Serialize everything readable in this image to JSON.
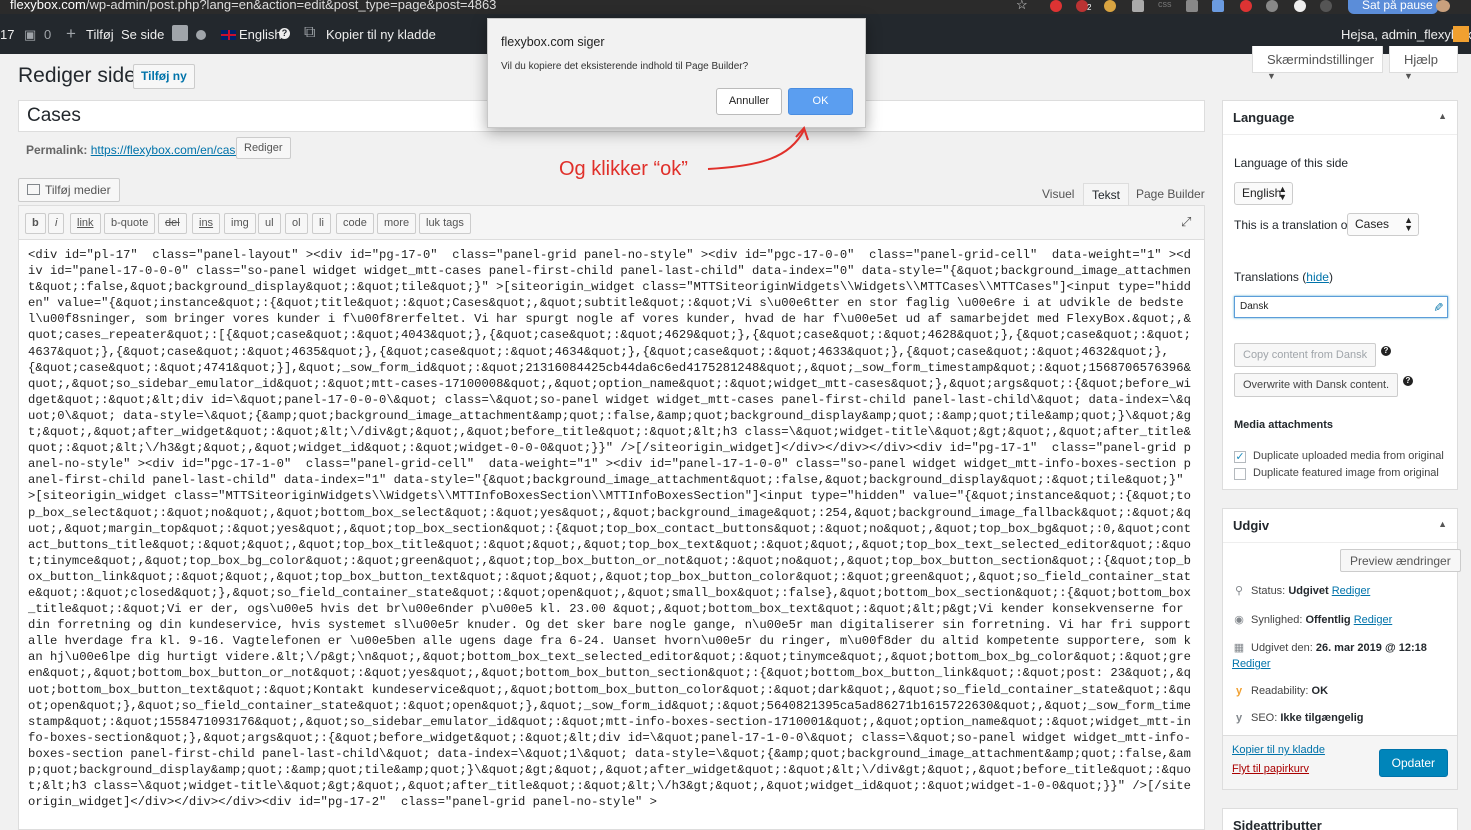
{
  "browser": {
    "url_host": "flexybox.com",
    "url_path": "/wp-admin/post.php?lang=en&action=edit&post_type=page&post=4863",
    "star_label": "☆",
    "badge_count": "2",
    "css_label": "css",
    "pause_label": "Sat på pause"
  },
  "admin_bar": {
    "counter": "17",
    "comments": "0",
    "add_new": "Tilføj",
    "view_page": "Se side",
    "language": "English",
    "help_mark": "?",
    "copy_draft": "Kopier til ny kladde",
    "greeting": "Hejsa, admin_flexybox"
  },
  "header": {
    "screen_options": "Skærmindstillinger",
    "help": "Hjælp",
    "title": "Rediger side",
    "add_new": "Tilføj ny"
  },
  "post": {
    "title": "Cases",
    "permalink_label": "Permalink:",
    "permalink_url": "https://flexybox.com/en/cases/",
    "permalink_edit": "Rediger",
    "add_media": "Tilføj medier"
  },
  "editor": {
    "tabs": [
      "Visuel",
      "Tekst",
      "Page Builder"
    ],
    "quicktags": [
      "b",
      "i",
      "link",
      "b-quote",
      "del",
      "ins",
      "img",
      "ul",
      "ol",
      "li",
      "code",
      "more",
      "luk tags"
    ],
    "content": "<div id=\"pl-17\"  class=\"panel-layout\" ><div id=\"pg-17-0\"  class=\"panel-grid panel-no-style\" ><div id=\"pgc-17-0-0\"  class=\"panel-grid-cell\"  data-weight=\"1\" ><div id=\"panel-17-0-0-0\" class=\"so-panel widget widget_mtt-cases panel-first-child panel-last-child\" data-index=\"0\" data-style=\"{&quot;background_image_attachment&quot;:false,&quot;background_display&quot;:&quot;tile&quot;}\" >[siteorigin_widget class=\"MTTSiteoriginWidgets\\\\Widgets\\\\MTTCases\\\\MTTCases\"]<input type=\"hidden\" value=\"{&quot;instance&quot;:{&quot;title&quot;:&quot;Cases&quot;,&quot;subtitle&quot;:&quot;Vi s\\u00e6tter en stor faglig \\u00e6re i at udvikle de bedste l\\u00f8sninger, som bringer vores kunder i f\\u00f8rerfeltet. Vi har spurgt nogle af vores kunder, hvad de har f\\u00e5et ud af samarbejdet med FlexyBox.&quot;,&quot;cases_repeater&quot;:[{&quot;case&quot;:&quot;4043&quot;},{&quot;case&quot;:&quot;4629&quot;},{&quot;case&quot;:&quot;4628&quot;},{&quot;case&quot;:&quot;4637&quot;},{&quot;case&quot;:&quot;4635&quot;},{&quot;case&quot;:&quot;4634&quot;},{&quot;case&quot;:&quot;4633&quot;},{&quot;case&quot;:&quot;4632&quot;},\n{&quot;case&quot;:&quot;4741&quot;}],&quot;_sow_form_id&quot;:&quot;21316084425cb44da6c6ed4175281248&quot;,&quot;_sow_form_timestamp&quot;:&quot;1568706576396&quot;,&quot;so_sidebar_emulator_id&quot;:&quot;mtt-cases-17100008&quot;,&quot;option_name&quot;:&quot;widget_mtt-cases&quot;},&quot;args&quot;:{&quot;before_widget&quot;:&quot;&lt;div id=\\&quot;panel-17-0-0-0\\&quot; class=\\&quot;so-panel widget widget_mtt-cases panel-first-child panel-last-child\\&quot; data-index=\\&quot;0\\&quot; data-style=\\&quot;{&amp;quot;background_image_attachment&amp;quot;:false,&amp;quot;background_display&amp;quot;:&amp;quot;tile&amp;quot;}\\&quot;&gt;&quot;,&quot;after_widget&quot;:&quot;&lt;\\/div&gt;&quot;,&quot;before_title&quot;:&quot;&lt;h3 class=\\&quot;widget-title\\&quot;&gt;&quot;,&quot;after_title&quot;:&quot;&lt;\\/h3&gt;&quot;,&quot;widget_id&quot;:&quot;widget-0-0-0&quot;}}\" />[/siteorigin_widget]</div></div></div><div id=\"pg-17-1\"  class=\"panel-grid panel-no-style\" ><div id=\"pgc-17-1-0\"  class=\"panel-grid-cell\"  data-weight=\"1\" ><div id=\"panel-17-1-0-0\" class=\"so-panel widget widget_mtt-info-boxes-section panel-first-child panel-last-child\" data-index=\"1\" data-style=\"{&quot;background_image_attachment&quot;:false,&quot;background_display&quot;:&quot;tile&quot;}\" >[siteorigin_widget class=\"MTTSiteoriginWidgets\\\\Widgets\\\\MTTInfoBoxesSection\\\\MTTInfoBoxesSection\"]<input type=\"hidden\" value=\"{&quot;instance&quot;:{&quot;top_box_select&quot;:&quot;no&quot;,&quot;bottom_box_select&quot;:&quot;yes&quot;,&quot;background_image&quot;:254,&quot;background_image_fallback&quot;:&quot;&quot;,&quot;margin_top&quot;:&quot;yes&quot;,&quot;top_box_section&quot;:{&quot;top_box_contact_buttons&quot;:&quot;no&quot;,&quot;top_box_bg&quot;:0,&quot;contact_buttons_title&quot;:&quot;&quot;,&quot;top_box_title&quot;:&quot;&quot;,&quot;top_box_text&quot;:&quot;&quot;,&quot;top_box_text_selected_editor&quot;:&quot;tinymce&quot;,&quot;top_box_bg_color&quot;:&quot;green&quot;,&quot;top_box_button_or_not&quot;:&quot;no&quot;,&quot;top_box_button_section&quot;:{&quot;top_box_button_link&quot;:&quot;&quot;,&quot;top_box_button_text&quot;:&quot;&quot;,&quot;top_box_button_color&quot;:&quot;green&quot;,&quot;so_field_container_state&quot;:&quot;closed&quot;},&quot;so_field_container_state&quot;:&quot;open&quot;,&quot;small_box&quot;:false},&quot;bottom_box_section&quot;:{&quot;bottom_box_title&quot;:&quot;Vi er der, ogs\\u00e5 hvis det br\\u00e6nder p\\u00e5 kl. 23.00 &quot;,&quot;bottom_box_text&quot;:&quot;&lt;p&gt;Vi kender konsekvenserne for din forretning og din kundeservice, hvis systemet sl\\u00e5r knuder. Og det sker bare nogle gange, n\\u00e5r man digitaliserer sin forretning. Vi har fri support alle hverdage fra kl. 9-16. Vagtelefonen er \\u00e5ben alle ugens dage fra 6-24. Uanset hvorn\\u00e5r du ringer, m\\u00f8der du altid kompetente supportere, som kan hj\\u00e6lpe dig hurtigt videre.&lt;\\/p&gt;\\n&quot;,&quot;bottom_box_text_selected_editor&quot;:&quot;tinymce&quot;,&quot;bottom_box_bg_color&quot;:&quot;green&quot;,&quot;bottom_box_button_or_not&quot;:&quot;yes&quot;,&quot;bottom_box_button_section&quot;:{&quot;bottom_box_button_link&quot;:&quot;post: 23&quot;,&quot;bottom_box_button_text&quot;:&quot;Kontakt kundeservice&quot;,&quot;bottom_box_button_color&quot;:&quot;dark&quot;,&quot;so_field_container_state&quot;:&quot;open&quot;},&quot;so_field_container_state&quot;:&quot;open&quot;},&quot;_sow_form_id&quot;:&quot;5640821395ca5ad86271b1615722630&quot;,&quot;_sow_form_timestamp&quot;:&quot;1558471093176&quot;,&quot;so_sidebar_emulator_id&quot;:&quot;mtt-info-boxes-section-1710001&quot;,&quot;option_name&quot;:&quot;widget_mtt-info-boxes-section&quot;},&quot;args&quot;:{&quot;before_widget&quot;:&quot;&lt;div id=\\&quot;panel-17-1-0-0\\&quot; class=\\&quot;so-panel widget widget_mtt-info-boxes-section panel-first-child panel-last-child\\&quot; data-index=\\&quot;1\\&quot; data-style=\\&quot;{&amp;quot;background_image_attachment&amp;quot;:false,&amp;quot;background_display&amp;quot;:&amp;quot;tile&amp;quot;}\\&quot;&gt;&quot;,&quot;after_widget&quot;:&quot;&lt;\\/div&gt;&quot;,&quot;before_title&quot;:&quot;&lt;h3 class=\\&quot;widget-title\\&quot;&gt;&quot;,&quot;after_title&quot;:&quot;&lt;\\/h3&gt;&quot;,&quot;widget_id&quot;:&quot;widget-1-0-0&quot;}}\" />[/siteorigin_widget]</div></div></div><div id=\"pg-17-2\"  class=\"panel-grid panel-no-style\" >"
  },
  "language_box": {
    "title": "Language",
    "language_of_label": "Language of this side",
    "language_value": "English",
    "translation_of_label": "This is a translation of",
    "translation_of_value": "Cases",
    "translations_label": "Translations",
    "hide_link": "hide",
    "translation_input": "Dansk",
    "copy_button": "Copy content from Dansk",
    "overwrite_button": "Overwrite with Dansk content.",
    "media_heading": "Media attachments",
    "dup_uploaded": "Duplicate uploaded media from original",
    "dup_uploaded_checked": true,
    "dup_featured": "Duplicate featured image from original",
    "dup_featured_checked": false
  },
  "publish_box": {
    "title": "Udgiv",
    "preview": "Preview ændringer",
    "status_label": "Status:",
    "status_value": "Udgivet",
    "visibility_label": "Synlighed:",
    "visibility_value": "Offentlig",
    "edit_link": "Rediger",
    "published_label": "Udgivet den:",
    "published_value": "26. mar 2019 @ 12:18",
    "readability_label": "Readability:",
    "readability_value": "OK",
    "seo_label": "SEO:",
    "seo_value": "Ikke tilgængelig",
    "copy_draft": "Kopier til ny kladde",
    "trash": "Flyt til papirkurv",
    "update": "Opdater"
  },
  "attributes_box": {
    "title": "Sideattributter"
  },
  "dialog": {
    "title": "flexybox.com siger",
    "message": "Vil du kopiere det eksisterende indhold til Page Builder?",
    "cancel": "Annuller",
    "ok": "OK"
  },
  "annotation": {
    "text": "Og klikker “ok”",
    "color": "#e0302a"
  },
  "colors": {
    "admin_bar": "#23282d",
    "link": "#0073aa",
    "primary_button": "#0085ba",
    "dialog_ok": "#5b9ef0",
    "trash": "#a00"
  }
}
